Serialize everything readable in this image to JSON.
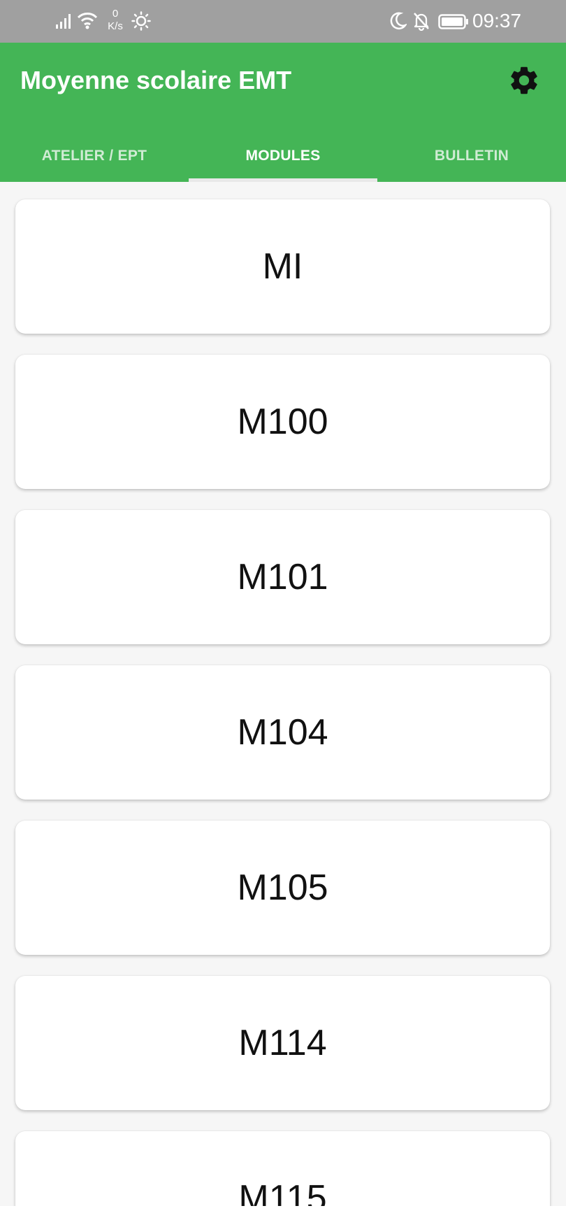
{
  "status_bar": {
    "speed_value": "0",
    "speed_unit": "K/s",
    "time": "09:37"
  },
  "app": {
    "title": "Moyenne scolaire EMT",
    "accent_color": "#44b556",
    "settings_icon": "gear-icon"
  },
  "tabs": [
    {
      "label": "ATELIER / EPT",
      "active": false
    },
    {
      "label": "MODULES",
      "active": true
    },
    {
      "label": "BULLETIN",
      "active": false
    }
  ],
  "modules": [
    {
      "label": "MI"
    },
    {
      "label": "M100"
    },
    {
      "label": "M101"
    },
    {
      "label": "M104"
    },
    {
      "label": "M105"
    },
    {
      "label": "M114"
    },
    {
      "label": "M115"
    }
  ]
}
